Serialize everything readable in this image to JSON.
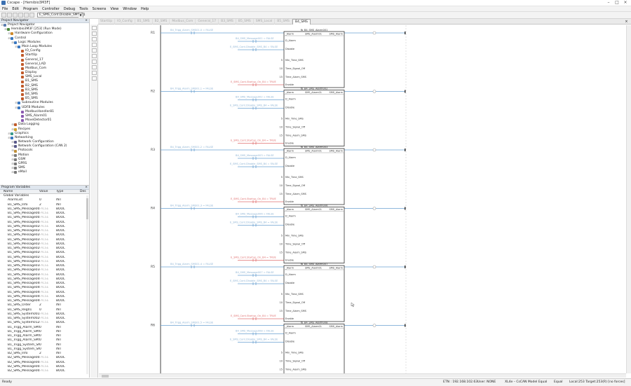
{
  "window": {
    "title": "Cscape - [Hemibio3M3F]",
    "controls": [
      "–",
      "□",
      "×"
    ]
  },
  "menu": [
    "File",
    "Edit",
    "Program",
    "Controller",
    "Debug",
    "Tools",
    "Screens",
    "View",
    "Window",
    "Help"
  ],
  "toolbar": {
    "combo_value": "E_SMS_Cont.Disable_SMS_B1"
  },
  "project_nav": {
    "title": "Project Navigator",
    "items": [
      {
        "label": "Project Navigator",
        "depth": 0,
        "icon": "#5b7db0"
      },
      {
        "label": "Hemibio3M3F [253] (Run Mode)",
        "depth": 1,
        "icon": "#4a8a3a"
      },
      {
        "label": "Hardware Configuration",
        "depth": 2,
        "icon": "#d08a2a"
      },
      {
        "label": "Control",
        "depth": 2,
        "icon": "#3a78c0"
      },
      {
        "label": "Logic Modules",
        "depth": 3,
        "icon": "#3a78c0"
      },
      {
        "label": "Main Loop Modules",
        "depth": 4,
        "icon": "#3a78c0"
      },
      {
        "label": "IO_Config",
        "depth": 5,
        "icon": "#c05a2a"
      },
      {
        "label": "StartUp",
        "depth": 5,
        "icon": "#c05a2a"
      },
      {
        "label": "General_17",
        "depth": 5,
        "icon": "#c05a2a"
      },
      {
        "label": "General_LAD",
        "depth": 5,
        "icon": "#c05a2a"
      },
      {
        "label": "Modbus_Com",
        "depth": 5,
        "icon": "#c05a2a"
      },
      {
        "label": "Display",
        "depth": 5,
        "icon": "#c05a2a"
      },
      {
        "label": "SMS_Local",
        "depth": 5,
        "icon": "#c05a2a"
      },
      {
        "label": "B1_SMS",
        "depth": 5,
        "icon": "#c05a2a"
      },
      {
        "label": "B2_SMS",
        "depth": 5,
        "icon": "#c05a2a"
      },
      {
        "label": "B3_SMS",
        "depth": 5,
        "icon": "#c05a2a"
      },
      {
        "label": "B4_SMS",
        "depth": 5,
        "icon": "#c05a2a"
      },
      {
        "label": "B5_SMS",
        "depth": 5,
        "icon": "#c05a2a"
      },
      {
        "label": "Subroutine Modules",
        "depth": 4,
        "icon": "#3a78c0"
      },
      {
        "label": "UDFB Modules",
        "depth": 4,
        "icon": "#3a78c0"
      },
      {
        "label": "ModbusHandler81",
        "depth": 5,
        "icon": "#8a5ab0"
      },
      {
        "label": "SMS_Alarm01",
        "depth": 5,
        "icon": "#8a5ab0"
      },
      {
        "label": "MoveDetector01",
        "depth": 5,
        "icon": "#8a5ab0"
      },
      {
        "label": "Data Logging",
        "depth": 3,
        "icon": "#c05a2a"
      },
      {
        "label": "Recipes",
        "depth": 3,
        "icon": "#d0a02a"
      },
      {
        "label": "Graphics",
        "depth": 2,
        "icon": "#3a9a8a"
      },
      {
        "label": "Networking",
        "depth": 2,
        "icon": "#3a78c0"
      },
      {
        "label": "Network Configuration",
        "depth": 3,
        "icon": "#5a5a8a"
      },
      {
        "label": "Network Configuration (CAN 2)",
        "depth": 3,
        "icon": "#5a5a8a"
      },
      {
        "label": "Protocols",
        "depth": 3,
        "icon": "#c0903a"
      },
      {
        "label": "Motion",
        "depth": 3,
        "icon": "#7a7a7a"
      },
      {
        "label": "GSM",
        "depth": 3,
        "icon": "#7a7a7a"
      },
      {
        "label": "GPRS",
        "depth": 3,
        "icon": "#7a7a7a"
      },
      {
        "label": "SMS",
        "depth": 3,
        "icon": "#7a7a7a"
      },
      {
        "label": "eMail",
        "depth": 3,
        "icon": "#7a7a7a"
      }
    ]
  },
  "program_vars": {
    "title": "Program Variables",
    "columns": [
      "Name",
      "Value",
      "Type",
      "Des"
    ],
    "group": "Global Variables",
    "rows": [
      {
        "name": "AlarmList",
        "value": "0",
        "type": "INT"
      },
      {
        "name": "B1_SMS_Info",
        "value": "2",
        "type": "INT"
      },
      {
        "name": "B1_SMS_Message001",
        "value": "FALSE",
        "type": "BOOL"
      },
      {
        "name": "B1_SMS_Message002",
        "value": "FALSE",
        "type": "BOOL"
      },
      {
        "name": "B1_SMS_Message003",
        "value": "FALSE",
        "type": "BOOL"
      },
      {
        "name": "B1_SMS_Message007",
        "value": "FALSE",
        "type": "BOOL"
      },
      {
        "name": "B1_SMS_Message020",
        "value": "FALSE",
        "type": "BOOL"
      },
      {
        "name": "B1_SMS_Message021",
        "value": "FALSE",
        "type": "BOOL"
      },
      {
        "name": "B1_SMS_Message022",
        "value": "FALSE",
        "type": "BOOL"
      },
      {
        "name": "B1_SMS_Message023",
        "value": "FALSE",
        "type": "BOOL"
      },
      {
        "name": "B1_SMS_Message024",
        "value": "FALSE",
        "type": "BOOL"
      },
      {
        "name": "B1_SMS_Message025",
        "value": "FALSE",
        "type": "BOOL"
      },
      {
        "name": "B1_SMS_Message026",
        "value": "FALSE",
        "type": "BOOL"
      },
      {
        "name": "B1_SMS_Message027",
        "value": "FALSE",
        "type": "BOOL"
      },
      {
        "name": "B1_SMS_Message030",
        "value": "FALSE",
        "type": "BOOL"
      },
      {
        "name": "B1_SMS_Message031",
        "value": "FALSE",
        "type": "BOOL"
      },
      {
        "name": "B1_SMS_Message032",
        "value": "FALSE",
        "type": "BOOL"
      },
      {
        "name": "B1_SMS_Message033",
        "value": "FALSE",
        "type": "BOOL"
      },
      {
        "name": "B1_SMS_Message040",
        "value": "FALSE",
        "type": "BOOL"
      },
      {
        "name": "B1_SMS_Message041",
        "value": "FALSE",
        "type": "BOOL"
      },
      {
        "name": "B1_SMS_Message042",
        "value": "FALSE",
        "type": "BOOL"
      },
      {
        "name": "B1_SMS_Message043",
        "value": "FALSE",
        "type": "BOOL"
      },
      {
        "name": "B1_SMS_Message044",
        "value": "FALSE",
        "type": "BOOL"
      },
      {
        "name": "B1_SMS_Message045",
        "value": "FALSE",
        "type": "BOOL"
      },
      {
        "name": "B1_SMS_Order",
        "value": "2",
        "type": "INT"
      },
      {
        "name": "B1_SMS_Reg01",
        "value": "0",
        "type": "INT"
      },
      {
        "name": "B1_SMS_System001",
        "value": "FALSE",
        "type": "BOOL"
      },
      {
        "name": "B1_SMS_System002",
        "value": "FALSE",
        "type": "BOOL"
      },
      {
        "name": "B1_SMS_System012",
        "value": "FALSE",
        "type": "BOOL"
      },
      {
        "name": "B1_Trigg_Alarm_SMS01",
        "value": "0",
        "type": "INT"
      },
      {
        "name": "B1_Trigg_Alarm_SMS02",
        "value": "0",
        "type": "INT"
      },
      {
        "name": "B1_Trigg_Alarm_SMS03",
        "value": "0",
        "type": "INT"
      },
      {
        "name": "B1_Trigg_Alarm_SMS04",
        "value": "0",
        "type": "INT"
      },
      {
        "name": "B1_Trigg_System_SMS...",
        "value": "0",
        "type": "INT"
      },
      {
        "name": "B1_Trigg_System_SMS...",
        "value": "0",
        "type": "INT"
      },
      {
        "name": "B2_SMS_Info",
        "value": "2",
        "type": "INT"
      },
      {
        "name": "B2_SMS_Message001",
        "value": "FALSE",
        "type": "BOOL"
      },
      {
        "name": "B2_SMS_Message002",
        "value": "FALSE",
        "type": "BOOL"
      },
      {
        "name": "B2_SMS_Message003",
        "value": "FALSE",
        "type": "BOOL"
      },
      {
        "name": "B2_SMS_Message007",
        "value": "FALSE",
        "type": "BOOL"
      }
    ]
  },
  "tabs": [
    "StartUp",
    "IO_Config",
    "B1_SMS",
    "B2_SMS",
    "Modbus_Com",
    "General_17",
    "B3_SMS",
    "B5_SMS",
    "SMS_Local",
    "B5_SMS",
    "B4_SMS"
  ],
  "active_tab": "B4_SMS",
  "rungs": [
    {
      "label": "R1",
      "fb_title": "fb_B4_SMS_Alarm001",
      "trig": "B4_Trigg_Alarm_SMS01.0 = FALSE",
      "msg": "B4_SMS_Message001 = FALSE",
      "disable": "E_SMS_Cont.Disable_SMS_B4 = FALSE",
      "startup": "E_SMS_Cont.Startup_On_B4 = TRUE"
    },
    {
      "label": "R2",
      "fb_title": "fb_B4_SMS_Alarm002",
      "trig": "B4_Trigg_Alarm_SMS01.1 = FALSE",
      "msg": "B4_SMS_Message002 = FALSE",
      "disable": "E_SMS_Cont.Disable_SMS_B4 = FALSE",
      "startup": "E_SMS_Cont.Startup_On_B4 = TRUE"
    },
    {
      "label": "R3",
      "fb_title": "fb_B4_SMS_Alarm003",
      "trig": "B4_Trigg_Alarm_SMS01.2 = FALSE",
      "msg": "B4_SMS_Message003 = FALSE",
      "disable": "E_SMS_Cont.Disable_SMS_B4 = FALSE",
      "startup": "E_SMS_Cont.Startup_On_B4 = TRUE"
    },
    {
      "label": "R4",
      "fb_title": "fb_B4_SMS_Alarm006",
      "trig": "B4_Trigg_Alarm_SMS01.3 = FALSE",
      "msg": "B4_SMS_Message006 = FALSE",
      "disable": "E_SMS_Cont.Disable_SMS_B4 = FALSE",
      "startup": "E_SMS_Cont.Startup_On_B4 = TRUE"
    },
    {
      "label": "R5",
      "fb_title": "fb_B4_SMS_Alarm007",
      "trig": "B4_Trigg_Alarm_SMS01.4 = FALSE",
      "msg": "B4_SMS_Message007 = FALSE",
      "disable": "E_SMS_Cont.Disable_SMS_B4 = FALSE",
      "startup": "E_SMS_Cont.Startup_On_B4 = TRUE"
    },
    {
      "label": "R6",
      "fb_title": "fb_B4_SMS_Alarm008",
      "trig": "B4_Trigg_Alarm_SMS01.5 = FALSE",
      "msg": "B4_SMS_Message008 = FALSE",
      "disable": "E_SMS_Cont.Disable_SMS_B4 = FALSE",
      "startup": "E_SMS_Cont.Startup_On_B4 = TRUE"
    }
  ],
  "fb": {
    "header_left": "_Alarm",
    "header_mid": "SMS_Alarm01",
    "header_right": "SMS_Alarm",
    "inputs": [
      "D_Alarm",
      "Disable",
      "Min_Time_SMS",
      "Time_Signal_Off",
      "Time_Alarm_SMS",
      "Enable"
    ],
    "input_values": [
      "",
      "",
      "5",
      "10",
      "15",
      ""
    ]
  },
  "status": {
    "left": "Ready",
    "ip": "ETN : 192.168.102.63",
    "user": "User: NONE",
    "model": "XL4e – CsCAN Model Equal",
    "equal": "Equal",
    "target": "Local:253  Target:253(R) [no forces]"
  }
}
